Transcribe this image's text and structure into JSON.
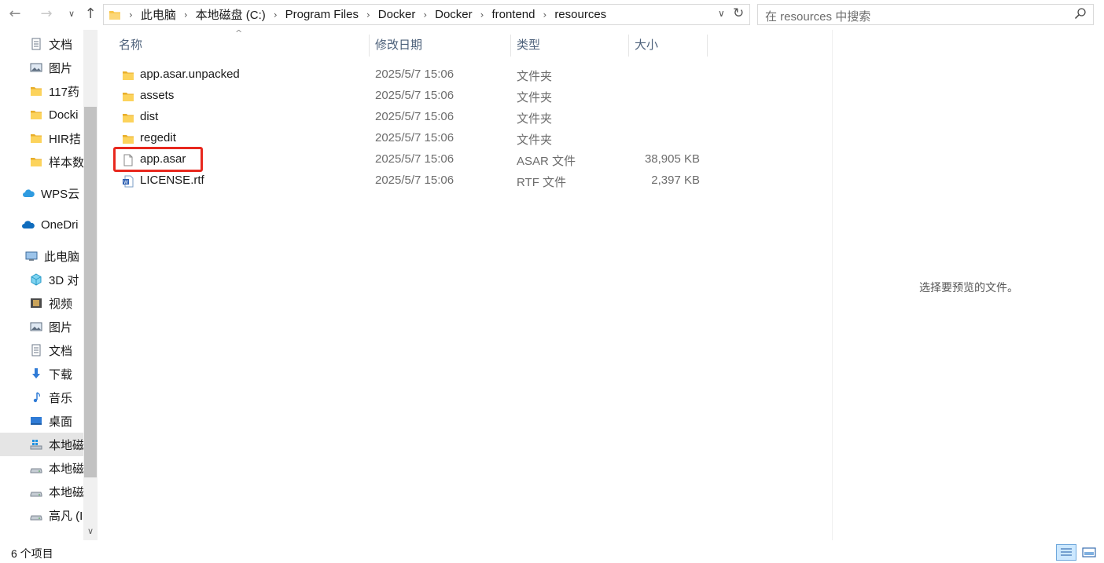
{
  "address_bar": {
    "breadcrumbs": [
      "此电脑",
      "本地磁盘 (C:)",
      "Program Files",
      "Docker",
      "Docker",
      "frontend",
      "resources"
    ]
  },
  "search": {
    "placeholder": "在 resources 中搜索"
  },
  "sidebar": {
    "items": [
      {
        "label": "文档",
        "icon": "document-icon",
        "pinned": true
      },
      {
        "label": "图片",
        "icon": "picture-icon",
        "pinned": true
      },
      {
        "label": "117药",
        "icon": "folder-icon"
      },
      {
        "label": "Docki",
        "icon": "folder-icon"
      },
      {
        "label": "HIR拮",
        "icon": "folder-icon"
      },
      {
        "label": "样本数",
        "icon": "folder-icon"
      },
      {
        "label": "WPS云",
        "icon": "cloud-icon"
      },
      {
        "label": "OneDri",
        "icon": "onedrive-icon"
      },
      {
        "label": "此电脑",
        "icon": "computer-icon"
      },
      {
        "label": "3D 对",
        "icon": "3d-objects-icon"
      },
      {
        "label": "视频",
        "icon": "video-icon"
      },
      {
        "label": "图片",
        "icon": "picture-icon"
      },
      {
        "label": "文档",
        "icon": "document-icon"
      },
      {
        "label": "下载",
        "icon": "download-icon"
      },
      {
        "label": "音乐",
        "icon": "music-icon"
      },
      {
        "label": "桌面",
        "icon": "desktop-icon"
      },
      {
        "label": "本地磁",
        "icon": "windows-drive-icon",
        "selected": true
      },
      {
        "label": "本地磁",
        "icon": "drive-icon"
      },
      {
        "label": "本地磁",
        "icon": "drive-icon"
      },
      {
        "label": "高凡 (I",
        "icon": "drive-icon"
      }
    ]
  },
  "columns": {
    "name": "名称",
    "date": "修改日期",
    "type": "类型",
    "size": "大小"
  },
  "files": [
    {
      "name": "app.asar.unpacked",
      "date": "2025/5/7 15:06",
      "type": "文件夹",
      "size": "",
      "icon": "folder-icon"
    },
    {
      "name": "assets",
      "date": "2025/5/7 15:06",
      "type": "文件夹",
      "size": "",
      "icon": "folder-icon"
    },
    {
      "name": "dist",
      "date": "2025/5/7 15:06",
      "type": "文件夹",
      "size": "",
      "icon": "folder-icon"
    },
    {
      "name": "regedit",
      "date": "2025/5/7 15:06",
      "type": "文件夹",
      "size": "",
      "icon": "folder-icon"
    },
    {
      "name": "app.asar",
      "date": "2025/5/7 15:06",
      "type": "ASAR 文件",
      "size": "38,905 KB",
      "icon": "file-icon",
      "highlighted": true
    },
    {
      "name": "LICENSE.rtf",
      "date": "2025/5/7 15:06",
      "type": "RTF 文件",
      "size": "2,397 KB",
      "icon": "word-document-icon"
    }
  ],
  "preview": {
    "message": "选择要预览的文件。"
  },
  "status": {
    "item_count": "6 个项目"
  },
  "colors": {
    "highlight_border": "#e8281e",
    "folder": "#f8c64a",
    "header_text": "#4c607a"
  }
}
